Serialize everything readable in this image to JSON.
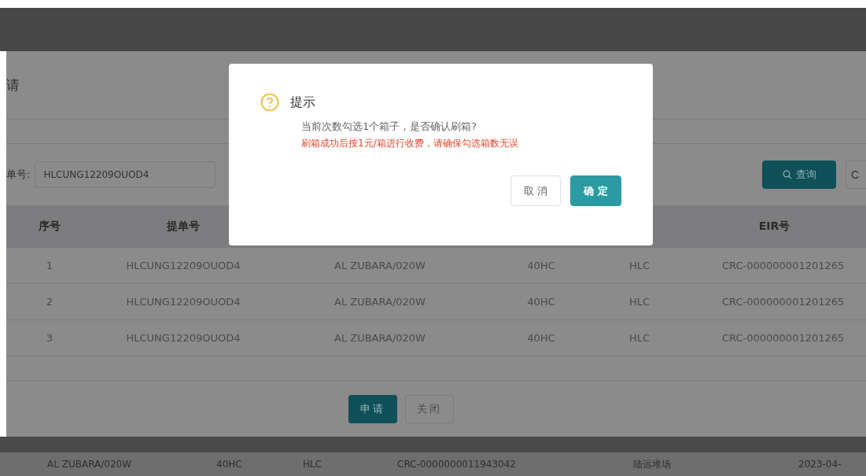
{
  "panel": {
    "title": "请",
    "filter": {
      "label": "单号:",
      "value": "HLCUNG12209OUOD4"
    },
    "buttons": [
      {
        "kind": "search",
        "label": "查询"
      },
      {
        "kind": "reset"
      }
    ],
    "table": {
      "columns": [
        "序号",
        "提单号",
        "",
        "",
        "",
        "EIR号"
      ],
      "rows": [
        [
          "1",
          "HLCUNG12209OUOD4",
          "AL ZUBARA/020W",
          "40HC",
          "HLC",
          "CRC-000000001201265"
        ],
        [
          "2",
          "HLCUNG12209OUOD4",
          "AL ZUBARA/020W",
          "40HC",
          "HLC",
          "CRC-000000001201265"
        ],
        [
          "3",
          "HLCUNG12209OUOD4",
          "AL ZUBARA/020W",
          "40HC",
          "HLC",
          "CRC-000000001201265"
        ]
      ]
    },
    "footer_buttons": [
      {
        "kind": "primary",
        "label": "申请"
      },
      {
        "kind": "default",
        "label": "关闭"
      }
    ]
  },
  "background_row": [
    "AL ZUBARA/020W",
    "40HC",
    "HLC",
    "CRC-0000000011943042",
    "陆远堆场",
    "2023-04-"
  ],
  "dialog": {
    "title": "提示",
    "message": "当前次数勾选1个箱子，是否确认刷箱?",
    "warning": "刷箱成功后按1元/箱进行收费，请确保勾选箱数无误",
    "buttons": [
      {
        "kind": "default",
        "label": "取 消"
      },
      {
        "kind": "primary",
        "label": "确 定"
      }
    ]
  }
}
